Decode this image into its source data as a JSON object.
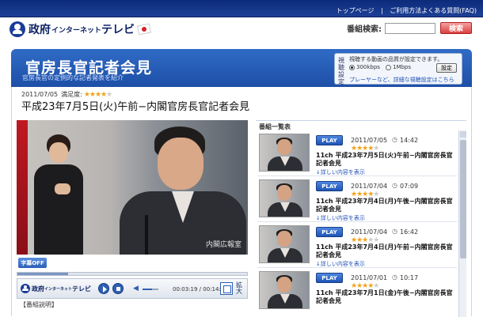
{
  "toplinks": [
    "トップページ",
    "ご利用方法よくある質問(FAQ)"
  ],
  "logo": {
    "main": "政府",
    "mid": "インターネット",
    "end": "テレビ"
  },
  "search": {
    "label": "番組検索:",
    "placeholder": "",
    "button": "検索"
  },
  "banner": {
    "title": "官房長官記者会見",
    "subtitle": "官房長官の定例的な記者発表を紹介"
  },
  "quality": {
    "side": "視聴設定",
    "note": "視聴する動画の品質が設定できます。",
    "option1": "300kbps",
    "option2": "1Mbps",
    "selected": "300kbps",
    "button": "設定",
    "link": "プレーヤーなど、詳細な視聴設定はこちら"
  },
  "video": {
    "date": "2011/07/05",
    "rating_label": "満足度:",
    "rating": 4,
    "title": "平成23年7月5日(火)午前−内閣官房長官記者会見",
    "watermark": "内閣広報室",
    "caption_button": "字幕OFF",
    "progress": 0.22,
    "time": "00:03:19 / 00:14:42",
    "volume": 0.6,
    "zoom_label": "拡大",
    "player_logo_main": "政府",
    "player_logo_mid": "インターネット",
    "player_logo_end": "テレビ"
  },
  "note_left": "【番組説明】",
  "list": {
    "title": "番組一覧表",
    "items": [
      {
        "date": "2011/07/05",
        "time": "14:42",
        "rating": 4,
        "title": "11ch 平成23年7月5日(火)午前−内閣官房長官記者会見",
        "detail": "↓詳しい内容を表示",
        "play": "PLAY"
      },
      {
        "date": "2011/07/04",
        "time": "07:09",
        "rating": 4,
        "title": "11ch 平成23年7月4日(月)午後−内閣官房長官記者会見",
        "detail": "↓詳しい内容を表示",
        "play": "PLAY"
      },
      {
        "date": "2011/07/04",
        "time": "16:42",
        "rating": 3,
        "title": "11ch 平成23年7月4日(月)午前−内閣官房長官記者会見",
        "detail": "↓詳しい内容を表示",
        "play": "PLAY"
      },
      {
        "date": "2011/07/01",
        "time": "10:17",
        "rating": 4,
        "title": "11ch 平成23年7月1日(金)午後−内閣官房長官記者会見",
        "detail": "",
        "play": "PLAY"
      }
    ]
  },
  "colors": {
    "accent": "#1f55b5",
    "banner": "#2f6bc6",
    "star": "#f2a21a",
    "search_button": "#d84040"
  }
}
